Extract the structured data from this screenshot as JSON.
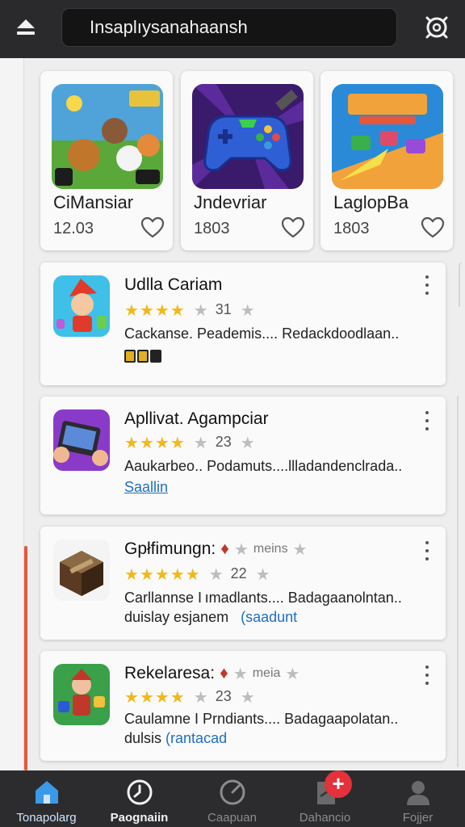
{
  "header": {
    "search_value": "Insaplıysanahaansh",
    "menu_icon": "eject-icon",
    "settings_icon": "gear-icon"
  },
  "featured": [
    {
      "title": "CiMansiar",
      "count": "12.03",
      "icon": "heart-outline-icon"
    },
    {
      "title": "Jndevriar",
      "count": "1803",
      "icon": "heart-outline-icon"
    },
    {
      "title": "LaglopBa",
      "count": "1803",
      "icon": "heart-outline-icon"
    }
  ],
  "apps": [
    {
      "name": "Udlla Cariam",
      "rating": 4,
      "rating_count": "31",
      "desc": "Cackanse. Peademis.... Redackdoodlaan..",
      "extra": "",
      "link": ""
    },
    {
      "name": "Apllivat. Agampciar",
      "rating": 4,
      "rating_count": "23",
      "desc": "Aaukarbeo.. Podamuts....llladandenclrada..",
      "extra": "",
      "link": "Saallin"
    },
    {
      "name": "Gpłfimungn:",
      "meta": "meins",
      "rating": 5,
      "rating_count": "22",
      "desc": "Carllannse I ımadlants.... Badagaanolntan..",
      "extra": "duislay esjanem",
      "link": "(saadunt"
    },
    {
      "name": "Rekelaresa:",
      "meta": "meia",
      "rating": 4,
      "rating_count": "23",
      "desc": "Caulamne I Prndiants.... Badagaapolatan..",
      "extra": "dulsis",
      "link": "(rantacad"
    }
  ],
  "nav": [
    {
      "label": "Tonapolarg",
      "icon": "home-icon"
    },
    {
      "label": "Paognaiin",
      "icon": "clock-icon"
    },
    {
      "label": "Caapuan",
      "icon": "gauge-icon"
    },
    {
      "label": "Dahancio",
      "icon": "document-icon",
      "badge": "+"
    },
    {
      "label": "Fojjer",
      "icon": "user-icon"
    }
  ],
  "colors": {
    "accent_star": "#f2b81a",
    "link": "#1e6fc0",
    "badge": "#e5313a",
    "rail_accent": "#e8563a"
  }
}
